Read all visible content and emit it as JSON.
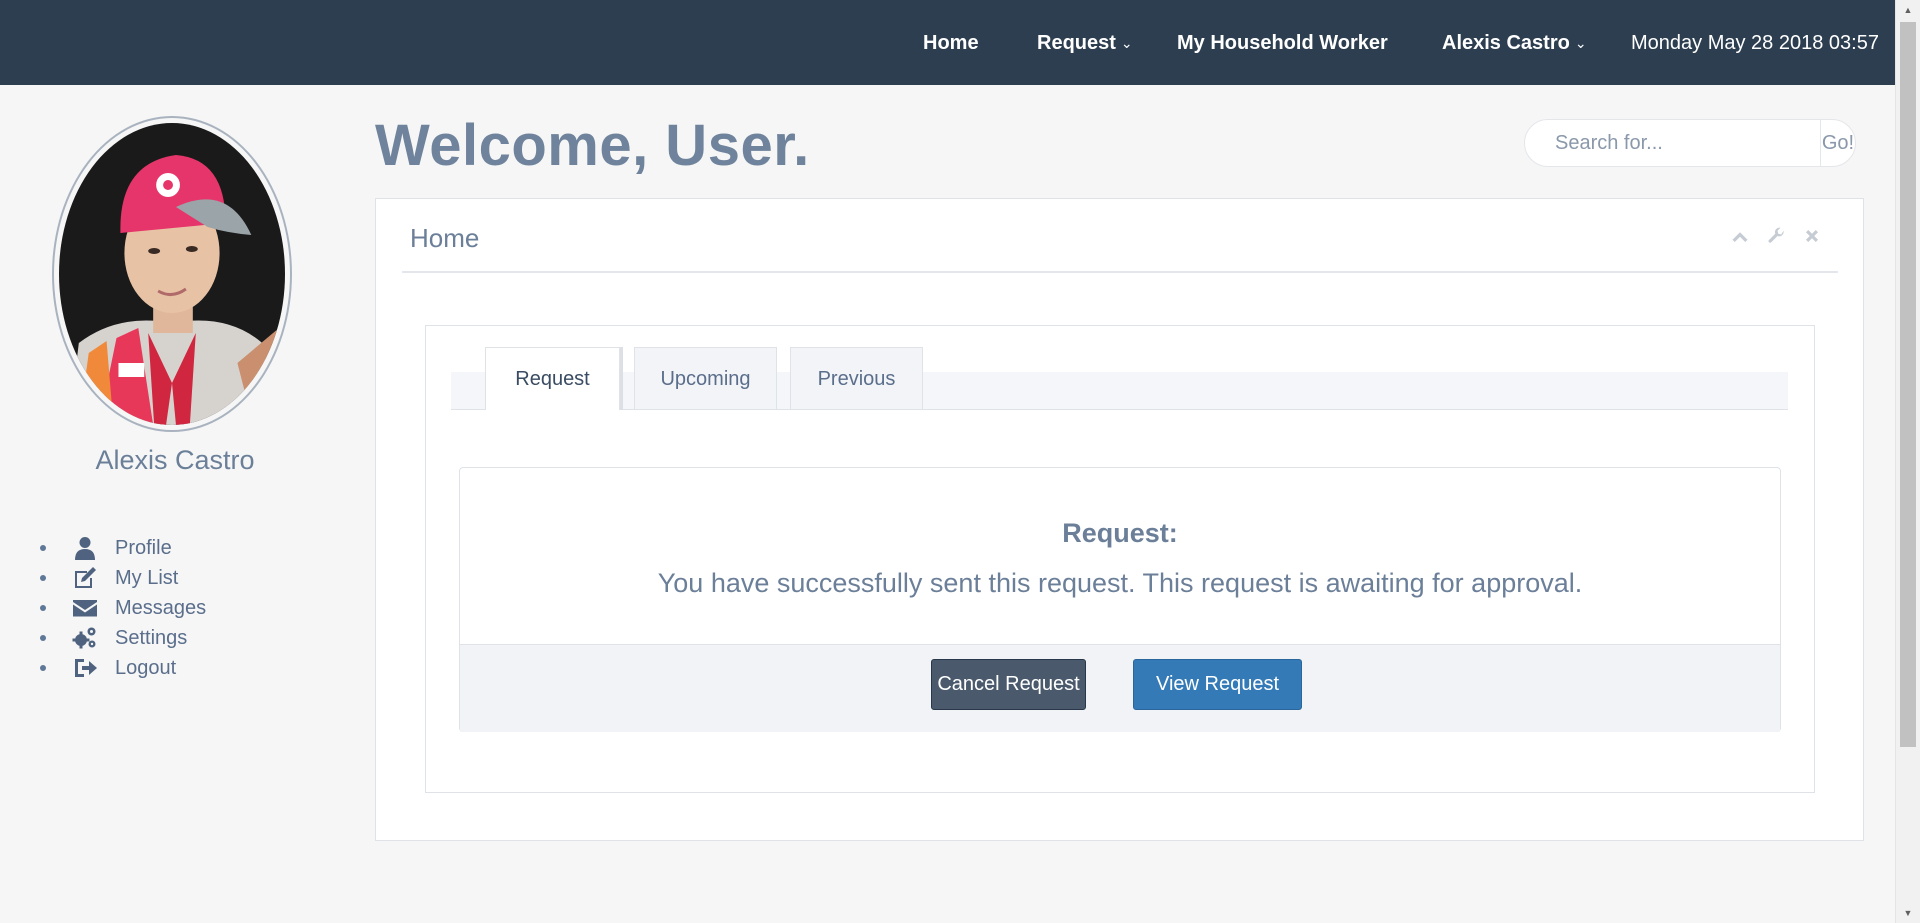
{
  "nav": {
    "home": "Home",
    "request": "Request",
    "my_household_worker": "My Household Worker",
    "user": "Alexis Castro",
    "datetime": "Monday May 28 2018 03:57",
    "caret_icon": "chevron-down-icon"
  },
  "sidebar": {
    "name": "Alexis Castro",
    "items": [
      {
        "label": "Profile",
        "icon": "user-icon"
      },
      {
        "label": "My List",
        "icon": "edit-icon"
      },
      {
        "label": "Messages",
        "icon": "envelope-icon"
      },
      {
        "label": "Settings",
        "icon": "gears-icon"
      },
      {
        "label": "Logout",
        "icon": "sign-out-icon"
      }
    ]
  },
  "main": {
    "title": "Welcome, User.",
    "search": {
      "placeholder": "Search for...",
      "value": "",
      "button": "Go!"
    },
    "panel": {
      "title": "Home",
      "tabs": [
        {
          "label": "Request",
          "active": true
        },
        {
          "label": "Upcoming",
          "active": false
        },
        {
          "label": "Previous",
          "active": false
        }
      ],
      "card": {
        "heading": "Request:",
        "message": "You have successfully sent this request. This request is awaiting for approval.",
        "cancel_button": "Cancel Request",
        "view_button": "View Request"
      }
    }
  },
  "colors": {
    "navbar": "#2c3e50",
    "primary_button": "#337ab7",
    "dark_button": "#4a5a6c",
    "text": "#6b7f99"
  }
}
